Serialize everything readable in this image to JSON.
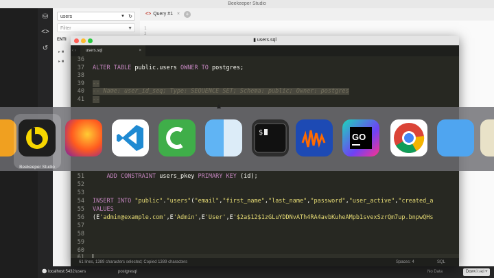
{
  "beekeeper": {
    "window_title": "Beekeeper Studio",
    "database": "users",
    "filter_placeholder": "Filter",
    "entities_label": "ENTI",
    "tab_label": "Query #1",
    "add_tab": "+",
    "gutter": [
      "1",
      "2"
    ],
    "status": {
      "connection": "localhost:5432/users",
      "db_type": "postgresql",
      "no_data": "No Data",
      "download": "Download"
    }
  },
  "editor": {
    "window_title": "users.sql",
    "tab_label": "users.sql",
    "lines": [
      {
        "num": "36",
        "text": ""
      },
      {
        "num": "37",
        "parts": [
          [
            "kw",
            "ALTER TABLE "
          ],
          [
            "",
            "public.users "
          ],
          [
            "kw",
            "OWNER TO "
          ],
          [
            "",
            "postgres;"
          ]
        ]
      },
      {
        "num": "38",
        "text": ""
      },
      {
        "num": "39",
        "cm": "--"
      },
      {
        "num": "40",
        "cm": "-- Name: user_id_seq; Type: SEQUENCE SET; Schema: public; Owner: postgres"
      },
      {
        "num": "41",
        "cm": "--"
      },
      {
        "num": "51",
        "parts": [
          [
            "",
            "    "
          ],
          [
            "kw",
            "ADD CONSTRAINT "
          ],
          [
            "",
            "users_pkey "
          ],
          [
            "kw",
            "PRIMARY KEY "
          ],
          [
            "",
            "(id);"
          ]
        ]
      },
      {
        "num": "52",
        "text": ""
      },
      {
        "num": "53",
        "text": ""
      },
      {
        "num": "54",
        "parts": [
          [
            "kw",
            "INSERT INTO "
          ],
          [
            "str",
            "\"public\""
          ],
          [
            "",
            "."
          ],
          [
            "str",
            "\"users\""
          ],
          [
            "",
            "("
          ],
          [
            "str",
            "\"email\""
          ],
          [
            "",
            ","
          ],
          [
            "str",
            "\"first_name\""
          ],
          [
            "",
            ","
          ],
          [
            "str",
            "\"last_name\""
          ],
          [
            "",
            ","
          ],
          [
            "str",
            "\"password\""
          ],
          [
            "",
            ","
          ],
          [
            "str",
            "\"user_active\""
          ],
          [
            "",
            ","
          ],
          [
            "str",
            "\"created_a"
          ]
        ]
      },
      {
        "num": "55",
        "parts": [
          [
            "kw",
            "VALUES"
          ]
        ]
      },
      {
        "num": "56",
        "parts": [
          [
            "",
            "(E"
          ],
          [
            "str",
            "'admin@example.com'"
          ],
          [
            "",
            ",E"
          ],
          [
            "str",
            "'Admin'"
          ],
          [
            "",
            ",E"
          ],
          [
            "str",
            "'User'"
          ],
          [
            "",
            ",E"
          ],
          [
            "str",
            "'$2a$12$1zGLuYDDNvATh4RA4avbKuheAMpb1svexSzrQm7up.bnpwQHs"
          ]
        ]
      },
      {
        "num": "57",
        "text": ""
      },
      {
        "num": "58",
        "text": ""
      },
      {
        "num": "59",
        "text": ""
      },
      {
        "num": "60",
        "text": ""
      },
      {
        "num": "61",
        "text": ""
      }
    ],
    "status": {
      "selection": "61 lines, 1389 characters selected; Copied 1389 characters",
      "spaces": "Spaces: 4",
      "language": "SQL"
    }
  },
  "dock": {
    "selected_app": "Beekeeper Studio",
    "apps": [
      "Beekeeper Studio",
      "Firefox",
      "Visual Studio Code",
      "Camtasia",
      "Finder",
      "Terminal",
      "Audacity",
      "GoLand",
      "Chrome",
      "TablePlus",
      "Preview"
    ]
  },
  "watermark": "Udemy",
  "colors": {
    "editor_bg": "#272822",
    "keyword": "#c586c0",
    "string": "#e6db74",
    "comment": "#75715e"
  }
}
